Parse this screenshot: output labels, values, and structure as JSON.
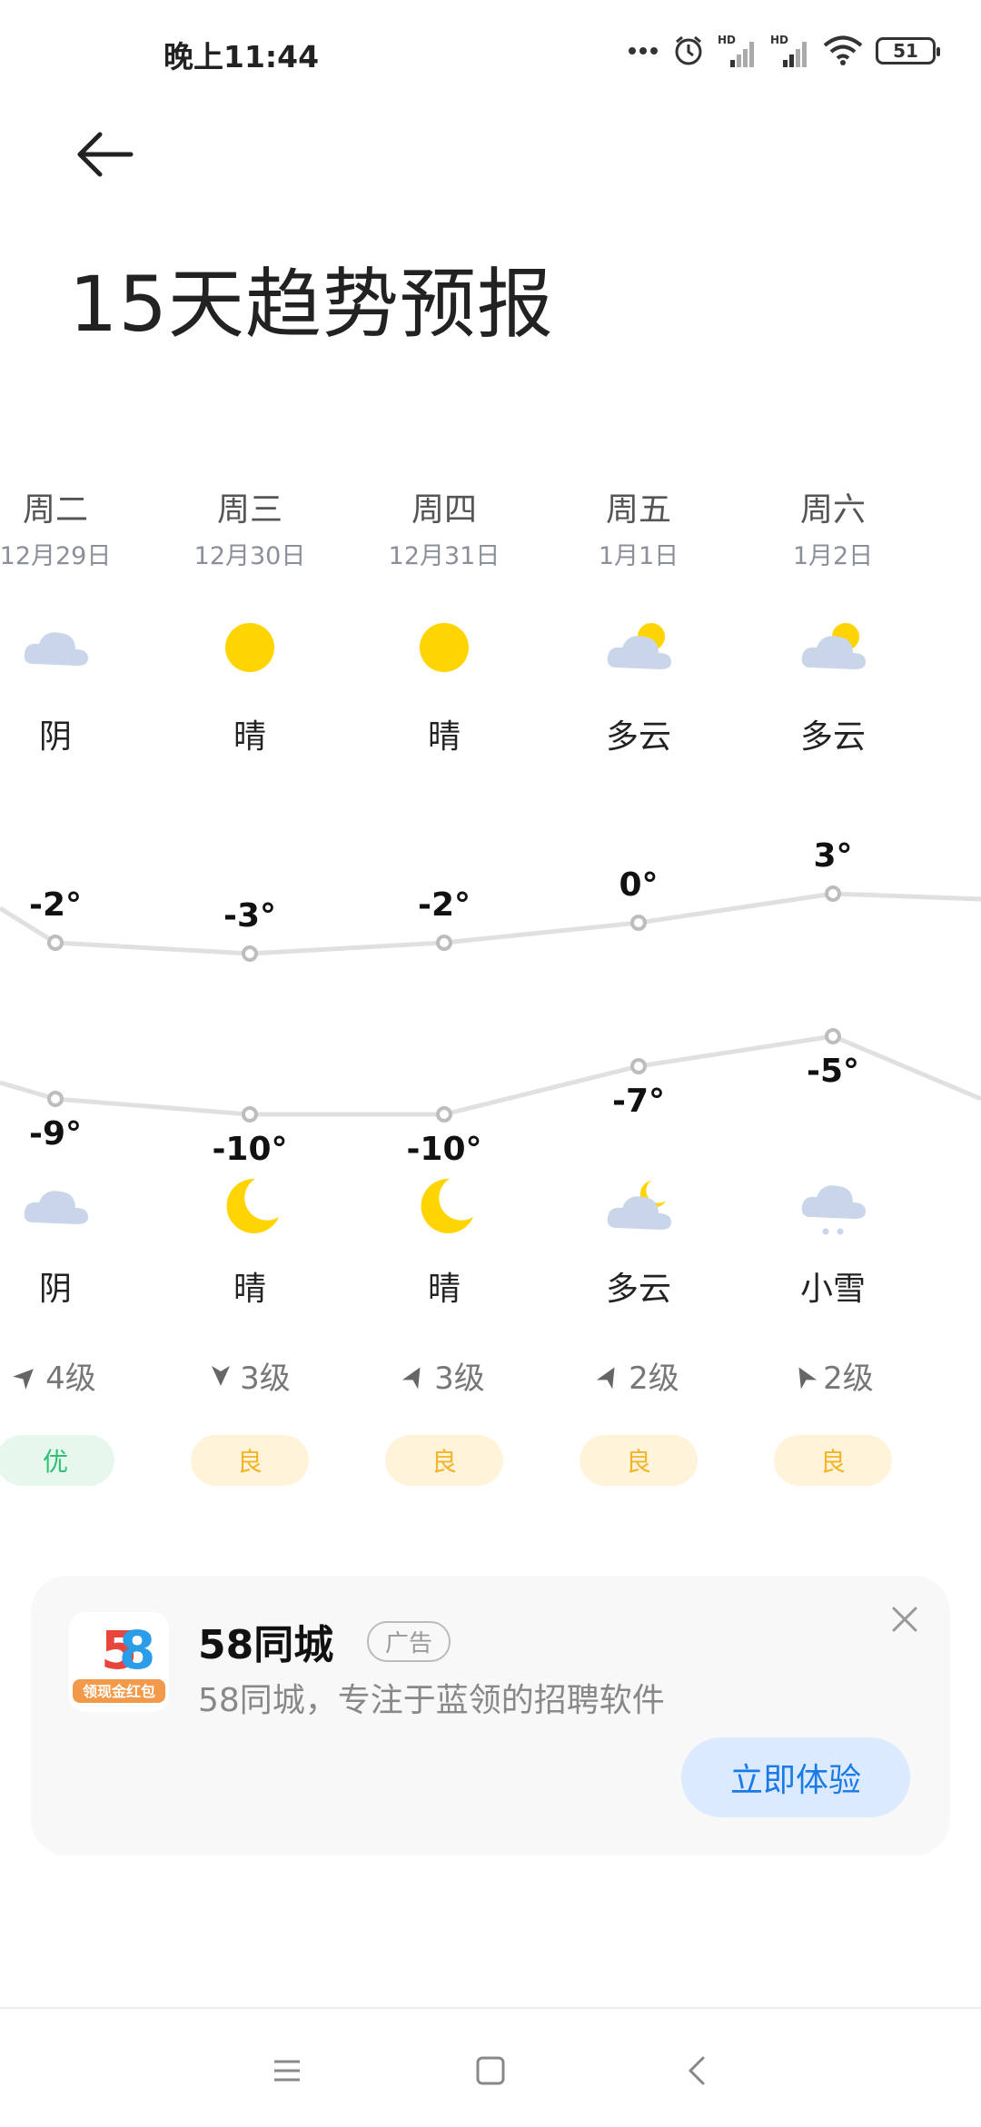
{
  "status_bar": {
    "time": "晚上11:44",
    "battery": "51",
    "icons": [
      "more-icon",
      "alarm-icon",
      "signal-hd-icon",
      "signal-hd-icon",
      "wifi-icon",
      "battery-icon"
    ]
  },
  "header": {
    "back_icon": "back-arrow-icon",
    "title": "15天趋势预报"
  },
  "forecast": {
    "days": [
      {
        "weekday": "周二",
        "date": "12月29日",
        "day_icon": "cloudy",
        "day_condition": "阴",
        "high": "-2°",
        "low": "-9°",
        "night_icon": "cloudy",
        "night_condition": "阴",
        "wind": "4级",
        "aqi": "优",
        "aqi_level": "good"
      },
      {
        "weekday": "周三",
        "date": "12月30日",
        "day_icon": "sunny",
        "day_condition": "晴",
        "high": "-3°",
        "low": "-10°",
        "night_icon": "moon",
        "night_condition": "晴",
        "wind": "3级",
        "aqi": "良",
        "aqi_level": "fair"
      },
      {
        "weekday": "周四",
        "date": "12月31日",
        "day_icon": "sunny",
        "day_condition": "晴",
        "high": "-2°",
        "low": "-10°",
        "night_icon": "moon",
        "night_condition": "晴",
        "wind": "3级",
        "aqi": "良",
        "aqi_level": "fair"
      },
      {
        "weekday": "周五",
        "date": "1月1日",
        "day_icon": "partly-cloudy",
        "day_condition": "多云",
        "high": "0°",
        "low": "-7°",
        "night_icon": "partly-cloudy-night",
        "night_condition": "多云",
        "wind": "2级",
        "aqi": "良",
        "aqi_level": "fair"
      },
      {
        "weekday": "周六",
        "date": "1月2日",
        "day_icon": "partly-cloudy",
        "day_condition": "多云",
        "high": "3°",
        "low": "-5°",
        "night_icon": "light-snow",
        "night_condition": "小雪",
        "wind": "2级",
        "aqi": "良",
        "aqi_level": "fair"
      }
    ]
  },
  "ad": {
    "logo_text": "58",
    "logo_subtext": "领现金红包",
    "title": "58同城",
    "badge": "广告",
    "description": "58同城，专注于蓝领的招聘软件",
    "cta": "立即体验"
  },
  "nav_bar": {
    "buttons": [
      "menu-icon",
      "home-icon",
      "back-icon"
    ]
  },
  "colors": {
    "sun": "#FFD400",
    "cloud": "#C9D6EA",
    "aqi_good_bg": "#E6F8EE",
    "aqi_fair_bg": "#FFF4D9",
    "cta_bg": "#DBEAFF",
    "cta_text": "#1A7AE8"
  }
}
